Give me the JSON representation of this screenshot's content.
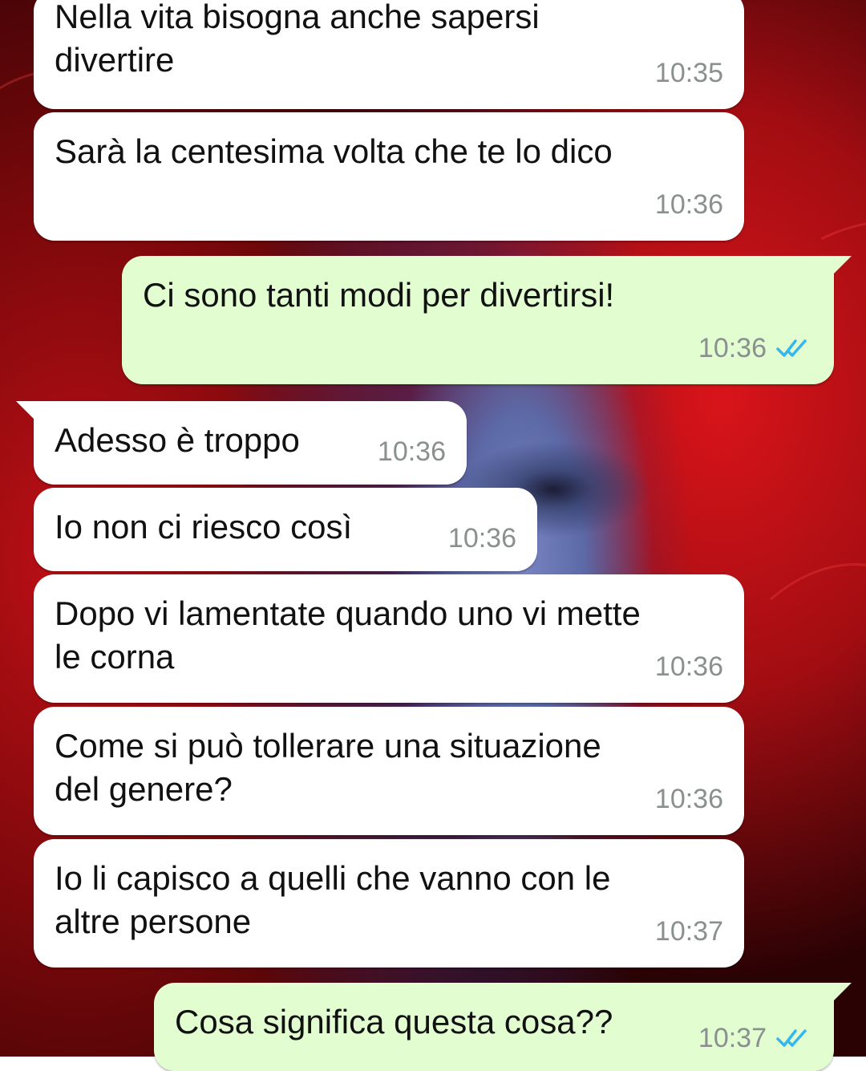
{
  "messages": [
    {
      "text": "Nella vita bisogna anche sapersi\ndivertire",
      "time": "10:35",
      "direction": "incoming"
    },
    {
      "text": "Sarà la centesima volta che te lo dico",
      "time": "10:36",
      "direction": "incoming"
    },
    {
      "text": "Ci sono tanti modi per divertirsi!",
      "time": "10:36",
      "direction": "outgoing",
      "status": "read"
    },
    {
      "text": "Adesso è troppo",
      "time": "10:36",
      "direction": "incoming"
    },
    {
      "text": "Io non ci riesco così",
      "time": "10:36",
      "direction": "incoming"
    },
    {
      "text": "Dopo vi lamentate quando uno vi mette\nle corna",
      "time": "10:36",
      "direction": "incoming"
    },
    {
      "text": "Come si può tollerare una situazione\ndel genere?",
      "time": "10:36",
      "direction": "incoming"
    },
    {
      "text": "Io li capisco a quelli che vanno con le\naltre persone",
      "time": "10:37",
      "direction": "incoming"
    },
    {
      "text": "Cosa significa questa cosa??",
      "time": "10:37",
      "direction": "outgoing",
      "status": "read"
    }
  ],
  "icons": {
    "read_receipt": "double-check-icon"
  },
  "colors": {
    "incoming_bubble": "#ffffff",
    "outgoing_bubble": "#e2fdd0",
    "timestamp": "#8a8f8f",
    "read_ticks": "#34b7f1"
  }
}
